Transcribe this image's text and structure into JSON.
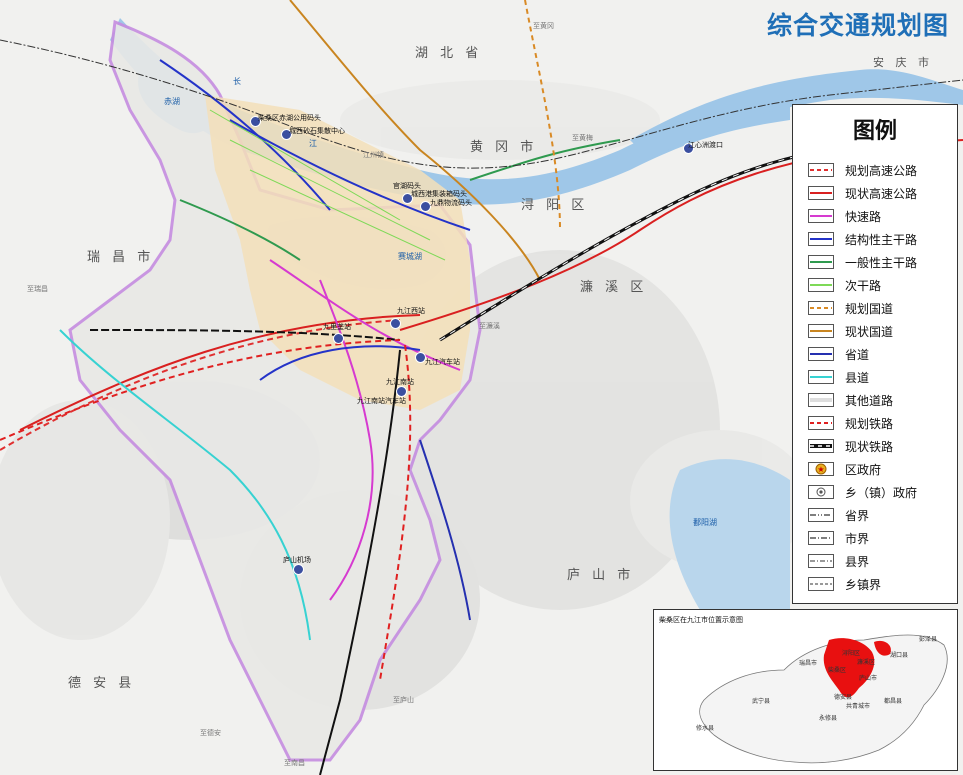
{
  "title": "综合交通规划图",
  "regions": {
    "hubei": "湖 北 省",
    "huanggang": "黄 冈 市",
    "anqing": "安 庆 市",
    "xunyang": "浔 阳 区",
    "lianxi": "濂 溪 区",
    "ruichang": "瑞 昌 市",
    "lushan": "庐 山 市",
    "dean": "德 安 县"
  },
  "waters": {
    "chihu": "赤湖",
    "changjiang_chang": "长",
    "changjiang_jiang": "江",
    "saichenghu": "赛城湖",
    "poyanghu": "鄱阳湖"
  },
  "places": {
    "jiangzhou": "江州镇",
    "zhi_ruichang": "至瑞昌",
    "zhi_huangmei": "至黄梅",
    "zhi_lushan": "至庐山",
    "zhi_dean": "至德安",
    "zhi_nanchang": "至南昌",
    "zhi_lianxi": "至濂溪",
    "zhi_huangpu": "至黄冈"
  },
  "stations": {
    "chihu_port": "柴桑区赤湖公用码头",
    "shicheng": "城西砂石集散中心",
    "chengxi": "官湖码头",
    "container": "城西港集装箱码头",
    "jiulong": "九鼎物流码头",
    "jiujiang_west": "九江西站",
    "jiulixi": "九里垄站",
    "bus_station": "九江汽车站",
    "jiujiang_south": "九江南站",
    "south_bus": "九江南站汽车站",
    "airport": "庐山机场",
    "jiangxin": "江心洲渡口"
  },
  "legend": {
    "title": "图例",
    "items": [
      {
        "label": "规划高速公路",
        "color": "#e03030",
        "style": "dashed"
      },
      {
        "label": "现状高速公路",
        "color": "#d92020",
        "style": "solid"
      },
      {
        "label": "快速路",
        "color": "#d63ad0",
        "style": "solid"
      },
      {
        "label": "结构性主干路",
        "color": "#2433c8",
        "style": "solid"
      },
      {
        "label": "一般性主干路",
        "color": "#2f9a4f",
        "style": "solid"
      },
      {
        "label": "次干路",
        "color": "#7ed957",
        "style": "solid"
      },
      {
        "label": "规划国道",
        "color": "#d98a25",
        "style": "dashed"
      },
      {
        "label": "现状国道",
        "color": "#c98520",
        "style": "solid"
      },
      {
        "label": "省道",
        "color": "#2530b0",
        "style": "solid"
      },
      {
        "label": "县道",
        "color": "#37d2d2",
        "style": "solid"
      },
      {
        "label": "其他道路",
        "color": "#bdbdbd",
        "style": "double"
      },
      {
        "label": "规划铁路",
        "color": "#e02020",
        "style": "rail-dashed"
      },
      {
        "label": "现状铁路",
        "color": "#111111",
        "style": "rail"
      },
      {
        "label": "区政府",
        "color": "#e8b020",
        "style": "star"
      },
      {
        "label": "乡（镇）政府",
        "color": "#555555",
        "style": "dot"
      },
      {
        "label": "省界",
        "color": "#333333",
        "style": "dashdotdot"
      },
      {
        "label": "市界",
        "color": "#333333",
        "style": "dashdot"
      },
      {
        "label": "县界",
        "color": "#333333",
        "style": "dashdot-thin"
      },
      {
        "label": "乡镇界",
        "color": "#333333",
        "style": "dash-thin"
      }
    ]
  },
  "inset": {
    "title": "柴桑区在九江市位置示意图",
    "labels": {
      "pengze": "彭泽县",
      "hukou": "湖口县",
      "xunyang": "浔阳区",
      "lianxi": "濂溪区",
      "ruichang": "瑞昌市",
      "chaisang": "柴桑区",
      "lushan": "庐山市",
      "wuning": "武宁县",
      "dean": "德安县",
      "gongqing": "共青城市",
      "duchang": "都昌县",
      "yongxiu": "永修县",
      "xiushui": "修水县"
    },
    "highlight_color": "#e81010"
  }
}
